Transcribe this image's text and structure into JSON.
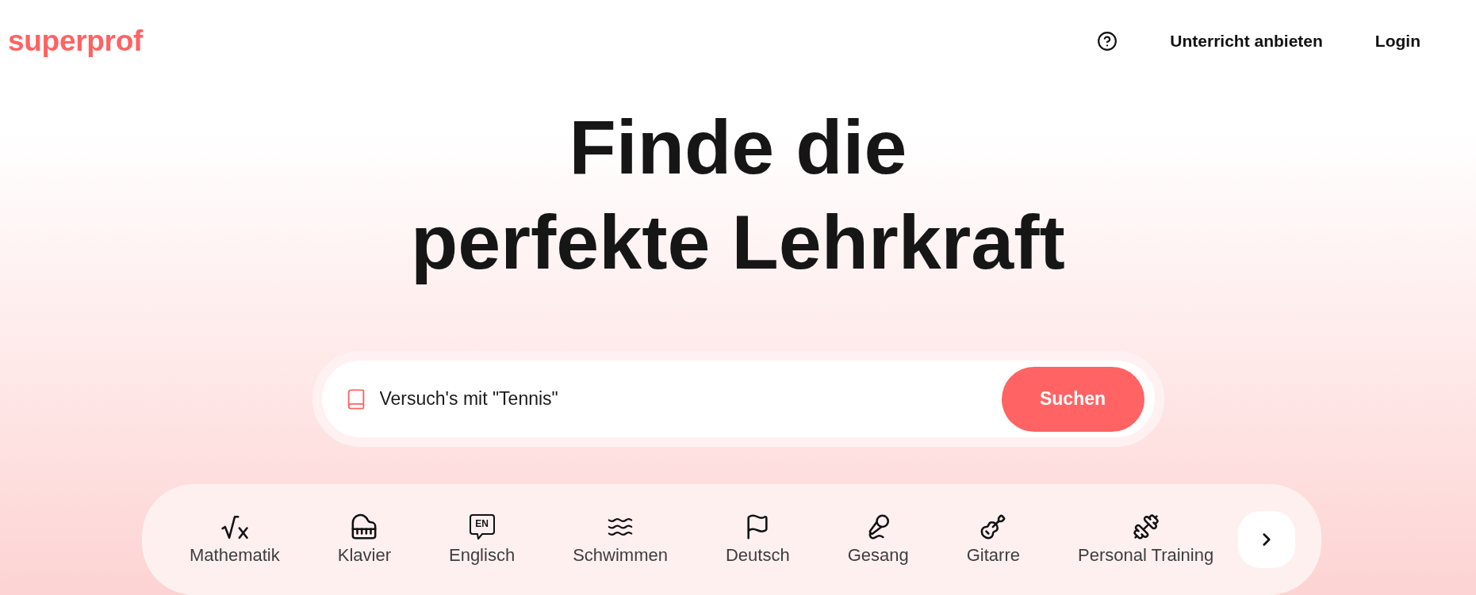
{
  "header": {
    "logo": "superprof",
    "nav": [
      {
        "label": "Unterricht anbieten"
      },
      {
        "label": "Login"
      }
    ]
  },
  "hero": {
    "title_lines": [
      "Finde die",
      "perfekte Lehrkraft"
    ]
  },
  "search": {
    "placeholder": "Versuch's mit \"Tennis\"",
    "button": "Suchen"
  },
  "categories": [
    {
      "label": "Mathematik"
    },
    {
      "label": "Klavier"
    },
    {
      "label": "Englisch",
      "icon_text": "EN"
    },
    {
      "label": "Schwimmen"
    },
    {
      "label": "Deutsch"
    },
    {
      "label": "Gesang"
    },
    {
      "label": "Gitarre"
    },
    {
      "label": "Personal Training"
    }
  ]
}
